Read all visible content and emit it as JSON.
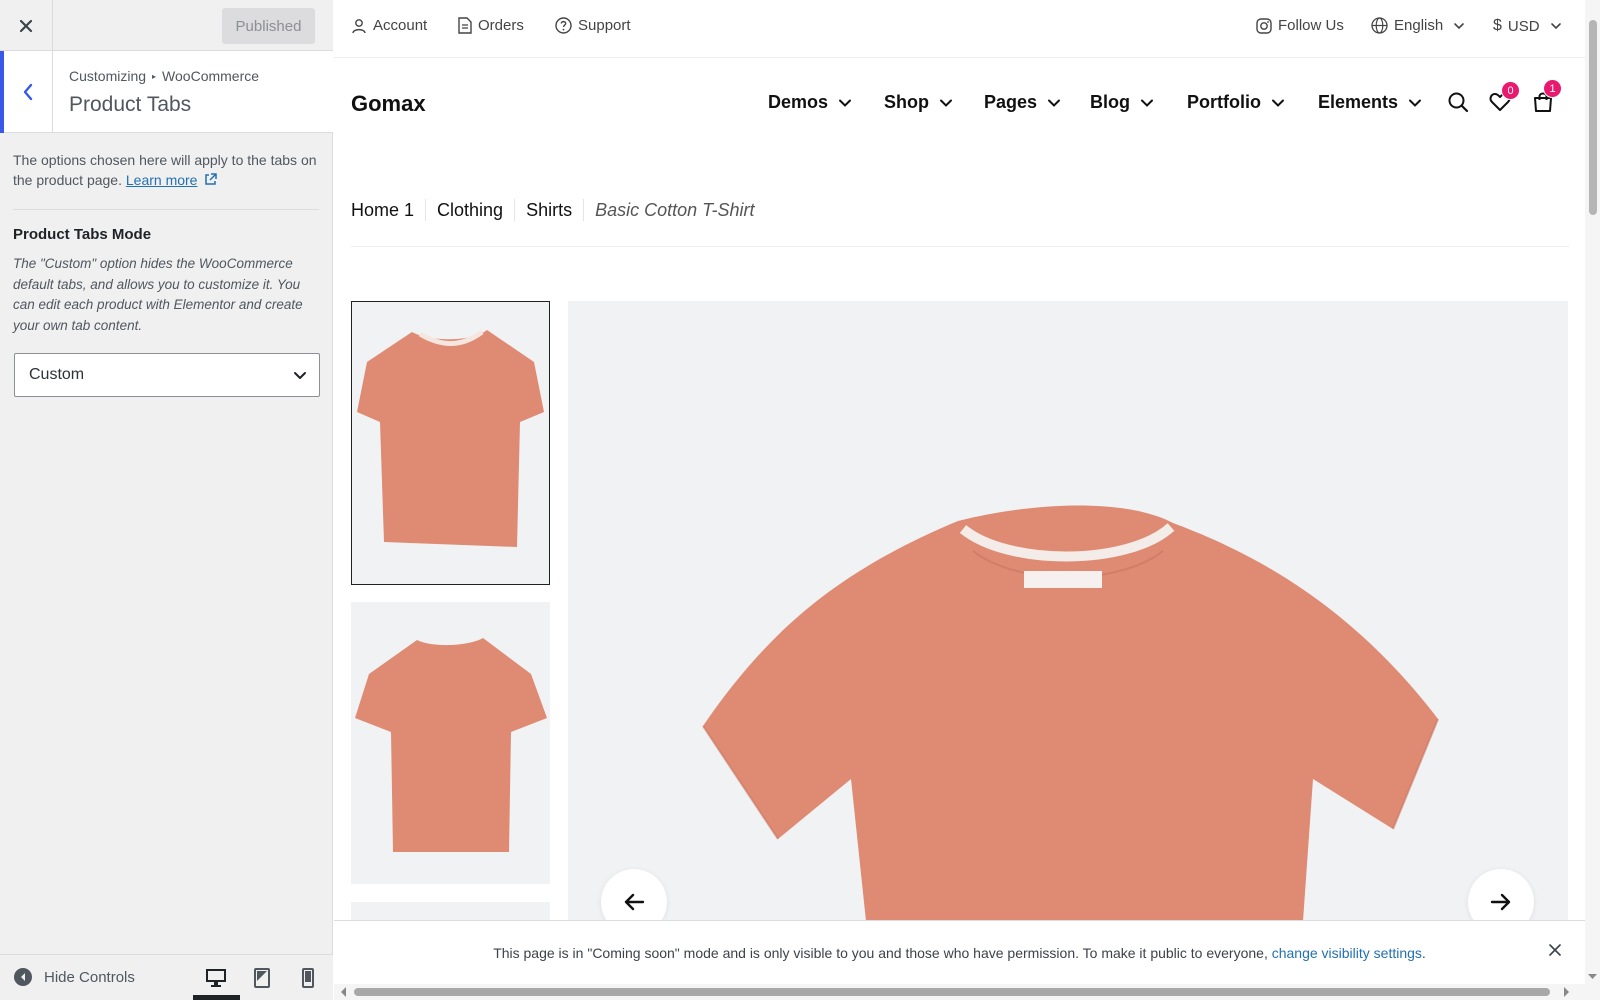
{
  "customizer": {
    "published_label": "Published",
    "breadcrumb": [
      "Customizing",
      "WooCommerce"
    ],
    "panel_title": "Product Tabs",
    "description": "The options chosen here will apply to the tabs on the product page.",
    "learn_more": "Learn more",
    "control_label": "Product Tabs Mode",
    "control_help": "The \"Custom\" option hides the WooCommerce default tabs, and allows you to customize it. You can edit each product with Elementor and create your own tab content.",
    "select_value": "Custom",
    "hide_controls": "Hide Controls",
    "devices": [
      "desktop-icon",
      "tablet-icon",
      "mobile-icon"
    ],
    "active_device": "desktop",
    "accent_color": "#3858e9"
  },
  "topbar": {
    "account": "Account",
    "orders": "Orders",
    "support": "Support",
    "follow_us": "Follow Us",
    "language": "English",
    "currency": "USD"
  },
  "header": {
    "logo": "Gomax",
    "nav": [
      "Demos",
      "Shop",
      "Pages",
      "Blog",
      "Portfolio",
      "Elements"
    ],
    "wishlist_count": "0",
    "cart_count": "1",
    "badge_color": "#e8196f"
  },
  "product": {
    "breadcrumb": [
      "Home 1",
      "Clothing",
      "Shirts",
      "Basic Cotton T-Shirt"
    ],
    "shirt_color": "#e08a72"
  },
  "notice": {
    "text": "This page is in \"Coming soon\" mode and is only visible to you and those who have permission. To make it public to everyone,",
    "link": "change visibility settings",
    "suffix": "."
  }
}
